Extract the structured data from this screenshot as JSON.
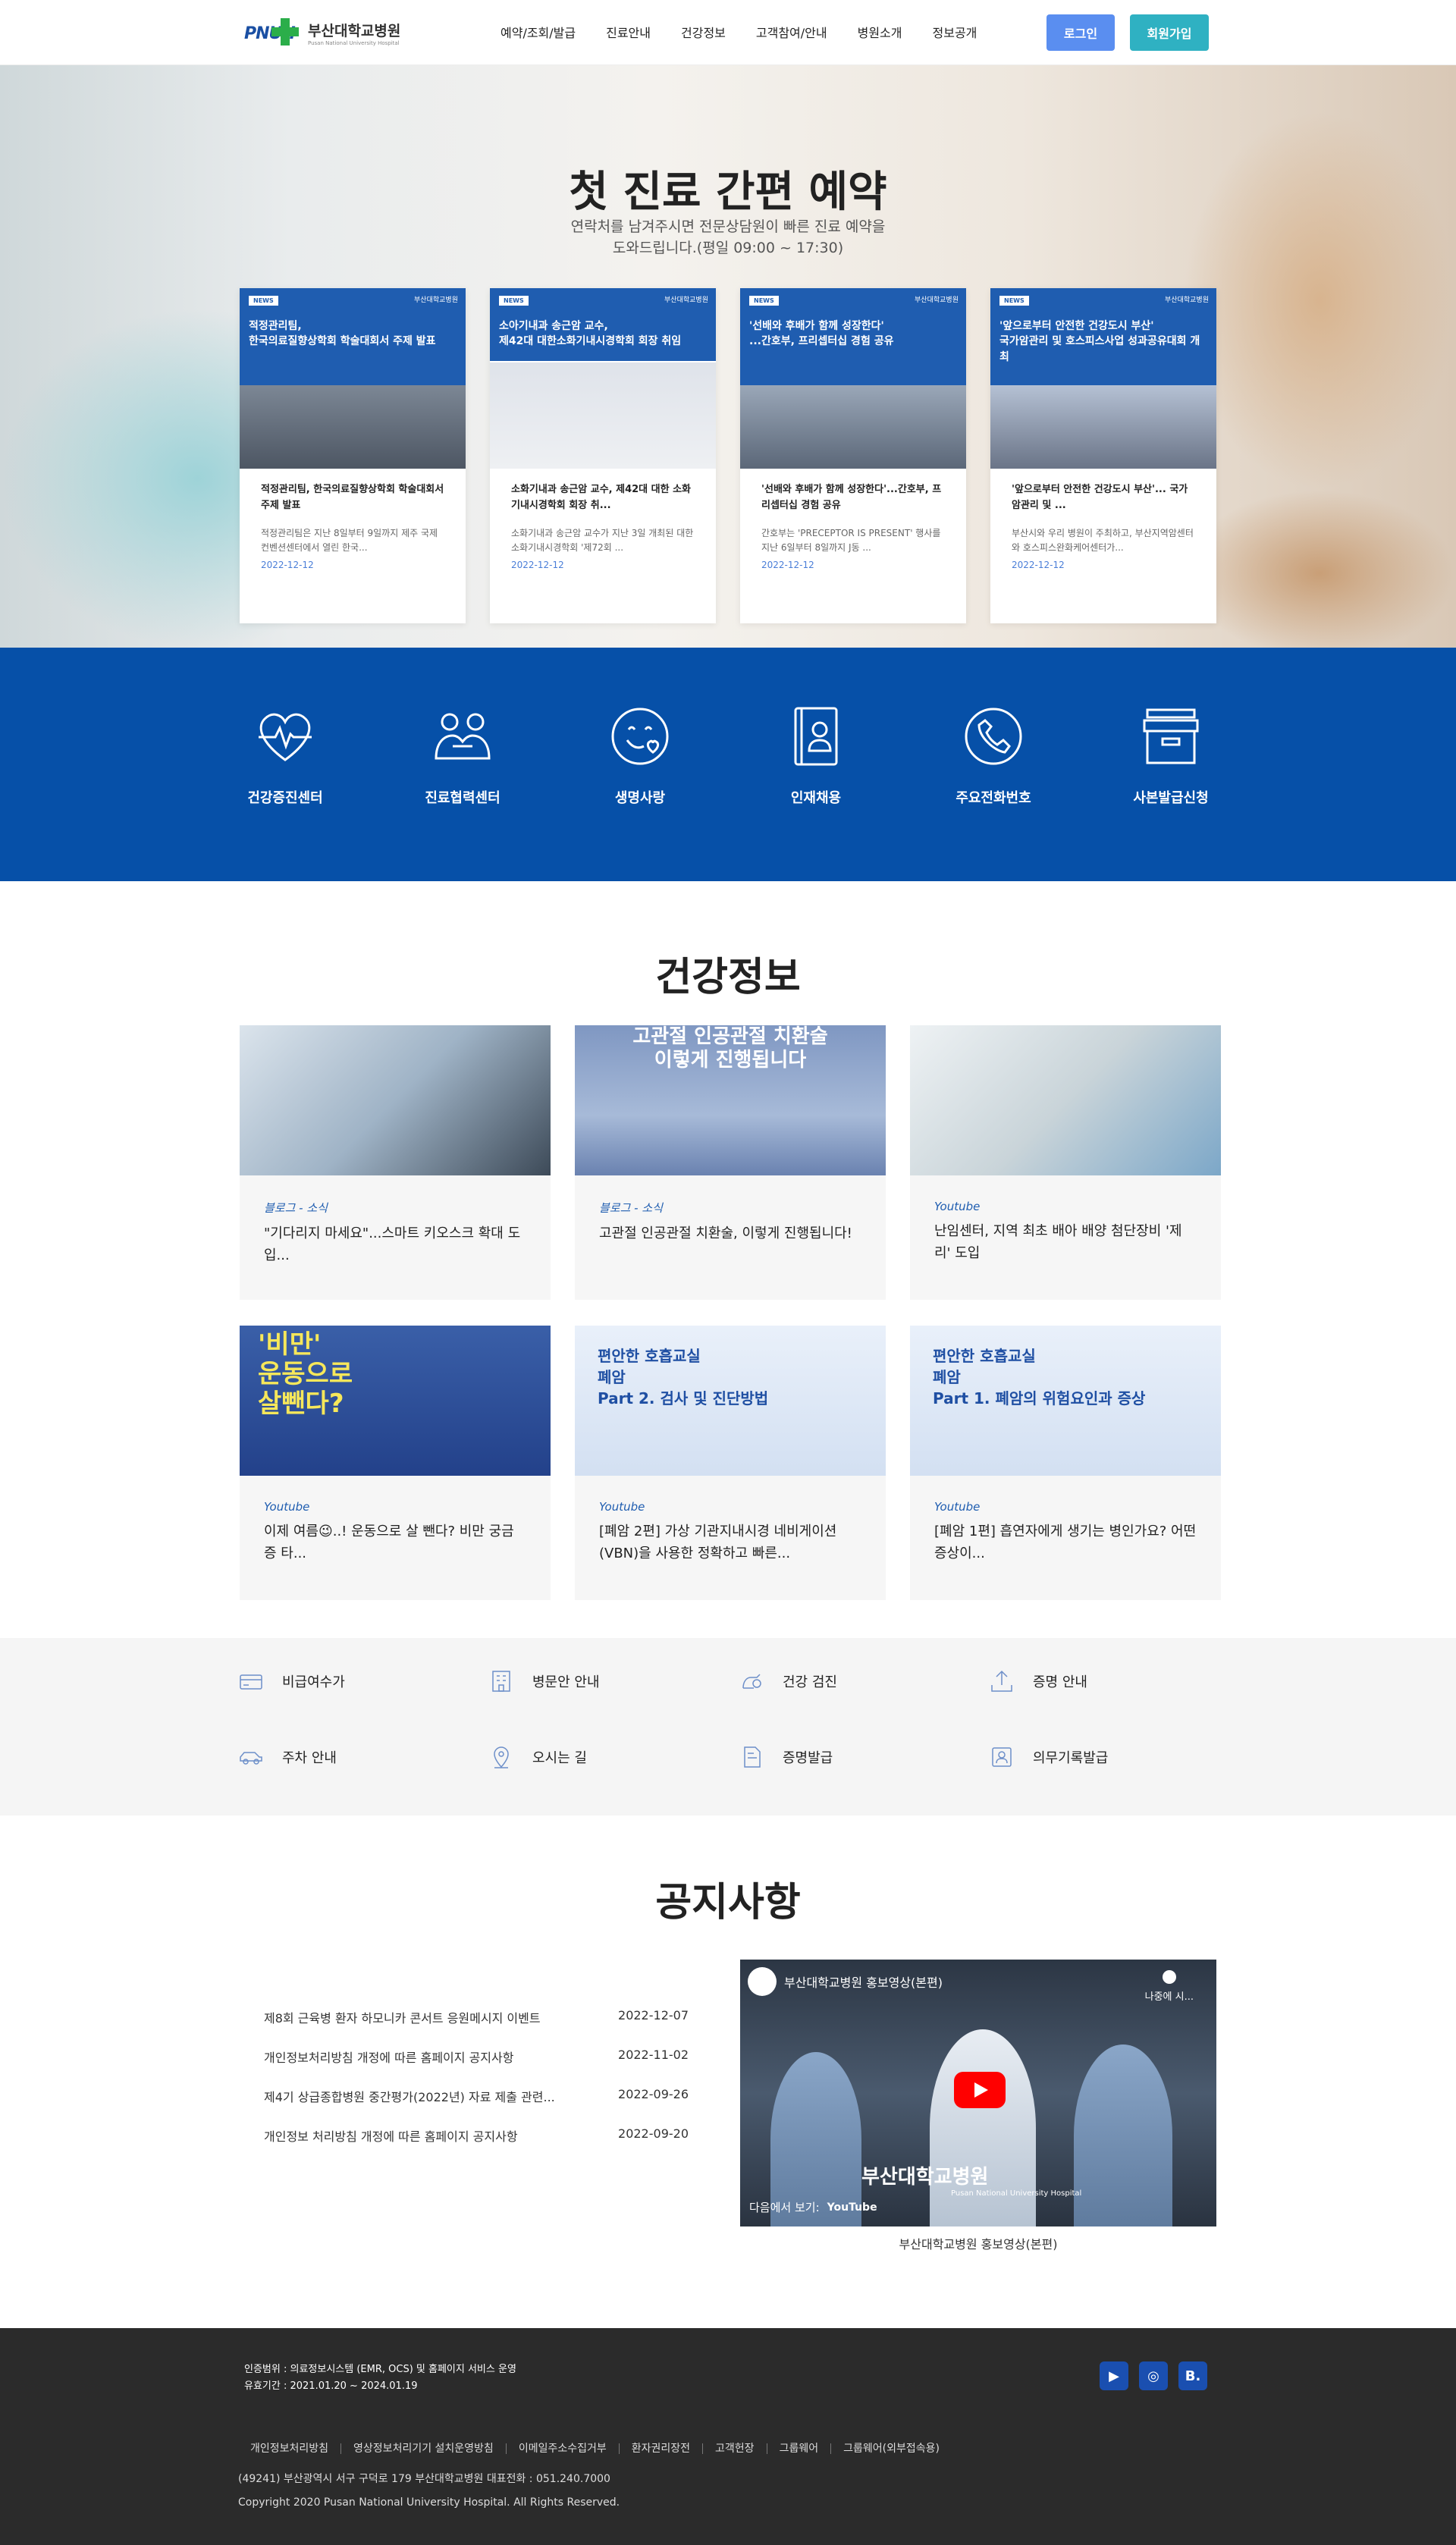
{
  "header": {
    "logo_mark": "PNUH",
    "logo_ko": "부산대학교병원",
    "logo_en": "Pusan National University Hospital",
    "nav": [
      "예약/조회/발급",
      "진료안내",
      "건강정보",
      "고객참여/안내",
      "병원소개",
      "정보공개"
    ],
    "login": "로그인",
    "join": "회원가입"
  },
  "hero": {
    "title": "첫 진료 간편 예약",
    "sub1": "연락처를 남겨주시면 전문상담원이 빠른 진료 예약을",
    "sub2": "도와드립니다.(평일 09:00 ~ 17:30)"
  },
  "news": [
    {
      "tag": "NEWS",
      "brand": "부산대학교병원",
      "head": "적정관리팀,\n한국의료질향상학회 학술대회서 주제 발표",
      "title": "적정관리팀, 한국의료질향상학회 학술대회서 주제 발표",
      "desc": "적정관리팀은 지난 8일부터 9일까지 제주 국제컨벤션센터에서 열린 한국...",
      "date": "2022-12-12"
    },
    {
      "tag": "NEWS",
      "brand": "부산대학교병원",
      "head": "소아기내과 송근암 교수,\n제42대 대한소화기내시경학회 회장 취임",
      "title": "소화기내과 송근암 교수, 제42대 대한 소화기내시경학회 회장 취...",
      "desc": "소화기내과 송근암 교수가 지난 3일 개최된 대한소화기내시경학회 '제72회 ...",
      "date": "2022-12-12"
    },
    {
      "tag": "NEWS",
      "brand": "부산대학교병원",
      "head": "'선배와 후배가 함께 성장한다'\n...간호부, 프리셉터십 경험 공유",
      "title": "'선배와 후배가 함께 성장한다'...간호부, 프리셉터십 경험 공유",
      "desc": "간호부는 'PRECEPTOR IS PRESENT' 행사를 지난 6일부터 8일까지 J동 ...",
      "date": "2022-12-12"
    },
    {
      "tag": "NEWS",
      "brand": "부산대학교병원",
      "head": "'앞으로부터 안전한 건강도시 부산'\n국가암관리 및 호스피스사업 성과공유대회 개최",
      "title": "'앞으로부터 안전한 건강도시 부산'... 국가암관리 및 ...",
      "desc": "부산시와 우리 병원이 주최하고, 부산지역암센터와 호스피스완화케어센터가...",
      "date": "2022-12-12"
    }
  ],
  "quick": [
    {
      "label": "건강증진센터",
      "icon": "heart-pulse-icon"
    },
    {
      "label": "진료협력센터",
      "icon": "handshake-people-icon"
    },
    {
      "label": "생명사랑",
      "icon": "smile-heart-icon"
    },
    {
      "label": "인재채용",
      "icon": "id-card-icon"
    },
    {
      "label": "주요전화번호",
      "icon": "phone-icon"
    },
    {
      "label": "사본발급신청",
      "icon": "archive-box-icon"
    }
  ],
  "health": {
    "title": "건강정보",
    "cards": [
      {
        "cat": "블로그 - 소식",
        "title": "\"기다리지 마세요\"...스마트 키오스크 확대 도입...",
        "thumb_text": ""
      },
      {
        "cat": "블로그 - 소식",
        "title": "고관절 인공관절 치환술, 이렇게 진행됩니다!",
        "thumb_text": "고관절 인공관절 치환술\n이렇게 진행됩니다"
      },
      {
        "cat": "Youtube",
        "title": "난임센터, 지역 최초 배아 배양 첨단장비 '제리' 도입",
        "thumb_text": ""
      },
      {
        "cat": "Youtube",
        "title": "이제 여름😉..! 운동으로 살 뺀다? 비만 궁금증 타...",
        "thumb_text": "'비만'\n운동으로\n살뺀다?"
      },
      {
        "cat": "Youtube",
        "title": "[폐암 2편] 가상 기관지내시경 네비게이션(VBN)을 사용한 정확하고 빠른...",
        "thumb_text": "편안한 호흡교실\n폐암\nPart 2. 검사 및 진단방법"
      },
      {
        "cat": "Youtube",
        "title": "[폐암 1편] 흡연자에게 생기는 병인가요? 어떤 증상이...",
        "thumb_text": "편안한 호흡교실\n폐암\nPart 1. 폐암의 위험요인과 증상"
      }
    ]
  },
  "services": [
    {
      "label": "비급여수가",
      "icon": "card-icon"
    },
    {
      "label": "병문안 안내",
      "icon": "building-icon"
    },
    {
      "label": "건강 검진",
      "icon": "checkup-icon"
    },
    {
      "label": "증명 안내",
      "icon": "upload-icon"
    },
    {
      "label": "주차 안내",
      "icon": "car-icon"
    },
    {
      "label": "오시는 길",
      "icon": "location-pin-icon"
    },
    {
      "label": "증명발급",
      "icon": "document-icon"
    },
    {
      "label": "의무기록발급",
      "icon": "record-icon"
    }
  ],
  "notice": {
    "title": "공지사항",
    "items": [
      {
        "text": "제8회 근육병 환자 하모니카 콘서트 응원메시지 이벤트",
        "date": "2022-12-07"
      },
      {
        "text": "개인정보처리방침 개정에 따른 홈페이지 공지사항",
        "date": "2022-11-02"
      },
      {
        "text": "제4기 상급종합병원 중간평가(2022년) 자료 제출 관련...",
        "date": "2022-09-26"
      },
      {
        "text": "개인정보 처리방침 개정에 따른 홈페이지 공지사항",
        "date": "2022-09-20"
      }
    ],
    "video_title": "부산대학교병원 홍보영상(본편)",
    "video_later": "나중에 시...",
    "video_brand": "부산대학교병원",
    "video_brand_en": "Pusan National University Hospital",
    "video_watch": "다음에서 보기:",
    "video_yt": "YouTube",
    "video_caption": "부산대학교병원 홍보영상(본편)"
  },
  "footer": {
    "cert1": "인증범위 : 의료정보시스템 (EMR, OCS) 및 홈페이지 서비스 운영",
    "cert2": "유효기간 : 2021.01.20 ~ 2024.01.19",
    "links": [
      "개인정보처리방침",
      "영상정보처리기기 설치운영방침",
      "이메일주소수집거부",
      "환자권리장전",
      "고객헌장",
      "그룹웨어",
      "그룹웨어(외부접속용)"
    ],
    "address": "(49241) 부산광역시 서구 구덕로 179 부산대학교병원 대표전화 : 051.240.7000",
    "copyright": "Copyright 2020 Pusan National University Hospital. All Rights Reserved.",
    "social": [
      "youtube-icon",
      "instagram-icon",
      "blog-icon"
    ]
  }
}
